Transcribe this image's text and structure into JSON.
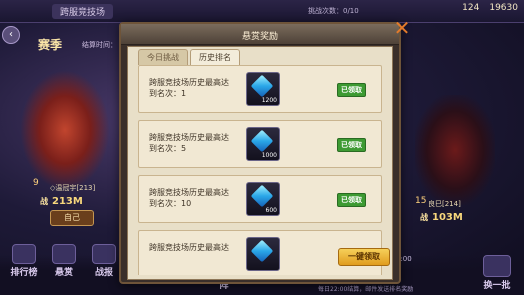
{
  "top": {
    "title": "跨服竞技场",
    "challenge_label": "挑战次数：0/10",
    "currency_a": "124",
    "currency_b": "19630"
  },
  "season": {
    "label": "赛季",
    "sub": "结算时间："
  },
  "left_player": {
    "rank": "9",
    "name": "◇温冠宇[213]",
    "power_label": "战",
    "power": "213M",
    "self_label": "自己"
  },
  "right_player": {
    "rank": "15",
    "name": "良巳[214]",
    "power_label": "战",
    "power": "103M"
  },
  "modal": {
    "title": "悬赏奖励",
    "tabs": [
      "今日挑战",
      "历史排名"
    ],
    "active_tab": 1,
    "rows": [
      {
        "label": "跨服竞技场历史最高达到名次：1",
        "gem_count": "1200",
        "status": "已领取"
      },
      {
        "label": "跨服竞技场历史最高达到名次：5",
        "gem_count": "1000",
        "status": "已领取"
      },
      {
        "label": "跨服竞技场历史最高达到名次：10",
        "gem_count": "600",
        "status": "已领取"
      },
      {
        "label": "跨服竞技场历史最高达",
        "gem_count": "",
        "status": ""
      }
    ],
    "claim_all_label": "一键领取"
  },
  "bottom_nav": [
    "排行榜",
    "悬赏",
    "战报",
    "商店",
    "布阵",
    "防御布阵"
  ],
  "swap_label": "换一批",
  "bottom_info": "每日22:00结算，邮件发送排名奖励",
  "bottom_time": "2:00",
  "colors": {
    "gem": "#2aa7e8",
    "status_green": "#3d9a32",
    "claim_gold": "#f6d05a"
  }
}
